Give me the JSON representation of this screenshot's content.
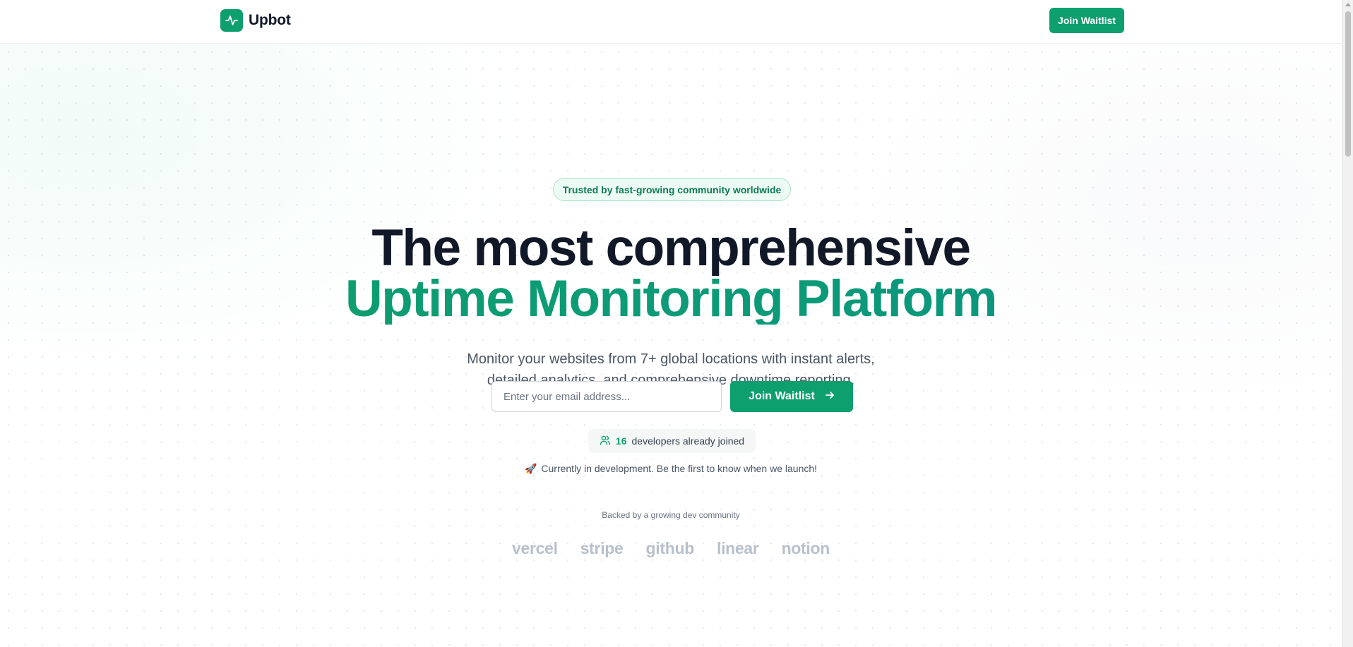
{
  "header": {
    "brand_name": "Upbot",
    "brand_icon": "activity-pulse-icon",
    "cta_label": "Join Waitlist"
  },
  "hero": {
    "badge": "Trusted by fast-growing community worldwide",
    "headline_line1": "The most comprehensive",
    "headline_line2": "Uptime Monitoring Platform",
    "subtitle_line1": "Monitor your websites from 7+ global locations with instant alerts,",
    "subtitle_line2": "detailed analytics, and comprehensive downtime reporting.",
    "email_placeholder": "Enter your email address...",
    "email_value": "",
    "join_label": "Join Waitlist",
    "join_icon": "arrow-right-icon",
    "joined_icon": "users-icon",
    "joined_count": "16",
    "joined_text": "developers already joined",
    "dev_note_icon": "rocket-emoji",
    "dev_note": "Currently in development. Be the first to know when we launch!",
    "backed_label": "Backed by a growing dev community",
    "logos": [
      "vercel",
      "stripe",
      "github",
      "linear",
      "notion"
    ]
  },
  "colors": {
    "accent": "#0e9f6e",
    "heading": "#111827",
    "muted_logo": "#b8c0cb",
    "badge_bg": "#ecfbf3"
  }
}
